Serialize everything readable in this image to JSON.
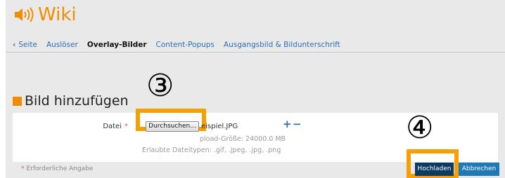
{
  "app": {
    "title": "Wiki",
    "icon": "speaker-icon",
    "accent": "#f08c00"
  },
  "tabs": {
    "back": "Seite",
    "items": [
      "Auslöser",
      "Overlay-Bilder",
      "Content-Popups",
      "Ausgangsbild & Bildunterschrift"
    ],
    "active": "Overlay-Bilder"
  },
  "section": {
    "title": "Bild hinzufügen"
  },
  "form": {
    "file_label": "Datei",
    "required_marker": "*",
    "browse_label": "Durchsuchen...",
    "filename": "eispiel.JPG",
    "add_symbol": "+",
    "remove_symbol": "−",
    "max_size_text": "pload-Größe: 24000.0 MB",
    "allowed_types_text": "Erlaubte Dateitypen: .gif, .jpeg, .jpg, .png"
  },
  "required_note": {
    "marker": "*",
    "text": "Erforderliche Angabe"
  },
  "buttons": {
    "upload": "Hochladen",
    "cancel": "Abbrechen"
  },
  "annotations": {
    "step3": "③",
    "step4": "④",
    "highlight_color": "#f5a000"
  }
}
